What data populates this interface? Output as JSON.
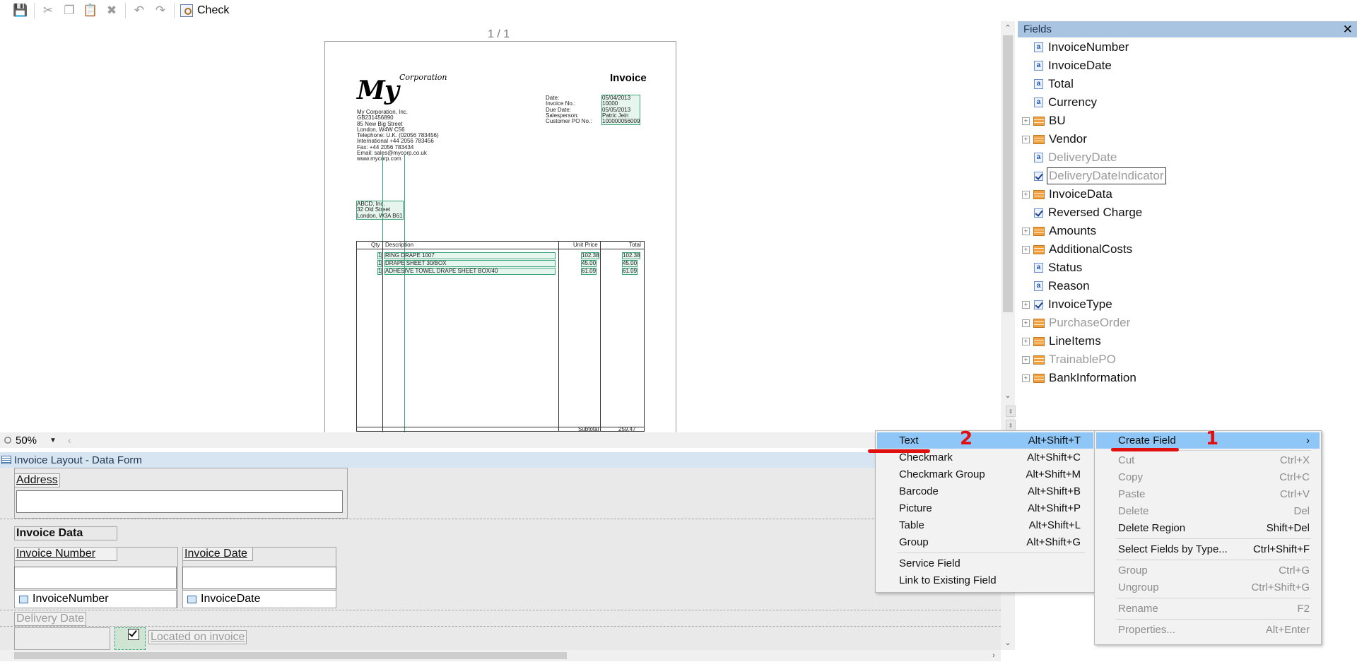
{
  "toolbar": {
    "check_label": "Check"
  },
  "viewer": {
    "page_counter": "1 / 1",
    "zoom": "50%",
    "doc": {
      "title": "Invoice",
      "logo_main": "My",
      "logo_sub": "Corporation",
      "company_block": "My Corporation, Inc.\nGB231456890\n85 New Big Street\nLondon, W4W C56\nTelephone: U.K. (02056 783456)\nInternational +44 2056 783456\nFax: +44 2056 783434\nEmail: sales@mycorp.co.uk\nwww.mycorp.com",
      "meta_labels": "Date:\nInvoice No.:\nDue Date:\nSalesperson:\nCustomer PO No.:",
      "meta_values": "05/04/2013\n10000\n05/05/2013\nPatric Jein\n100000056009",
      "customer_block": "ABCD, Inc.\n32 Old Street\nLondon, W3A B61",
      "table_headers": {
        "qty": "Qty",
        "description": "Description",
        "unit_price": "Unit Price",
        "total": "Total"
      },
      "table_rows": [
        {
          "qty": "1",
          "description": "RING DRAPE 1007",
          "unit_price": "102.38",
          "total": "102.38"
        },
        {
          "qty": "1",
          "description": "DRAPE SHEET 30/BOX",
          "unit_price": "45.00",
          "total": "45.00"
        },
        {
          "qty": "1",
          "description": "ADHESIVE TOWEL DRAPE SHEET BOX/40",
          "unit_price": "61.09",
          "total": "61.09"
        }
      ],
      "subtotal_label": "Subtotal",
      "subtotal_value": "259.47"
    }
  },
  "fields_panel": {
    "title": "Fields",
    "items": [
      {
        "label": "InvoiceNumber",
        "icon": "text-field-icon",
        "expandable": false,
        "disabled": false
      },
      {
        "label": "InvoiceDate",
        "icon": "text-field-icon",
        "expandable": false,
        "disabled": false
      },
      {
        "label": "Total",
        "icon": "text-field-icon",
        "expandable": false,
        "disabled": false
      },
      {
        "label": "Currency",
        "icon": "text-field-icon",
        "expandable": false,
        "disabled": false
      },
      {
        "label": "BU",
        "icon": "group-icon",
        "expandable": true,
        "disabled": false
      },
      {
        "label": "Vendor",
        "icon": "group-icon",
        "expandable": true,
        "disabled": false
      },
      {
        "label": "DeliveryDate",
        "icon": "text-field-icon",
        "expandable": false,
        "disabled": true
      },
      {
        "label": "DeliveryDateIndicator",
        "icon": "checkmark-icon",
        "expandable": false,
        "disabled": true,
        "selected": true
      },
      {
        "label": "InvoiceData",
        "icon": "group-icon",
        "expandable": true,
        "disabled": false
      },
      {
        "label": "Reversed Charge",
        "icon": "checkmark-icon",
        "expandable": false,
        "disabled": false
      },
      {
        "label": "Amounts",
        "icon": "group-icon",
        "expandable": true,
        "disabled": false
      },
      {
        "label": "AdditionalCosts",
        "icon": "group-icon",
        "expandable": true,
        "disabled": false
      },
      {
        "label": "Status",
        "icon": "text-field-icon",
        "expandable": false,
        "disabled": false
      },
      {
        "label": "Reason",
        "icon": "text-field-icon",
        "expandable": false,
        "disabled": false
      },
      {
        "label": "InvoiceType",
        "icon": "checkmark-icon",
        "expandable": true,
        "disabled": false
      },
      {
        "label": "PurchaseOrder",
        "icon": "group-icon",
        "expandable": true,
        "disabled": true
      },
      {
        "label": "LineItems",
        "icon": "group-icon",
        "expandable": true,
        "disabled": false
      },
      {
        "label": "TrainablePO",
        "icon": "group-icon",
        "expandable": true,
        "disabled": true
      },
      {
        "label": "BankInformation",
        "icon": "group-icon",
        "expandable": true,
        "disabled": false
      }
    ]
  },
  "data_form": {
    "title": "Invoice Layout - Data Form",
    "address_label": "Address",
    "invoice_data_label": "Invoice Data",
    "invoice_number_label": "Invoice Number",
    "invoice_date_label": "Invoice Date",
    "invoice_number_source": "InvoiceNumber",
    "invoice_date_source": "InvoiceDate",
    "delivery_date_label": "Delivery Date",
    "located_label": "Located on invoice"
  },
  "submenu": {
    "items": [
      {
        "label": "Text",
        "shortcut": "Alt+Shift+T",
        "highlight": true
      },
      {
        "label": "Checkmark",
        "shortcut": "Alt+Shift+C"
      },
      {
        "label": "Checkmark Group",
        "shortcut": "Alt+Shift+M"
      },
      {
        "label": "Barcode",
        "shortcut": "Alt+Shift+B"
      },
      {
        "label": "Picture",
        "shortcut": "Alt+Shift+P"
      },
      {
        "label": "Table",
        "shortcut": "Alt+Shift+L"
      },
      {
        "label": "Group",
        "shortcut": "Alt+Shift+G"
      },
      {
        "label": "Service Field",
        "shortcut": ""
      },
      {
        "label": "Link to Existing Field",
        "shortcut": ""
      }
    ]
  },
  "context_menu": {
    "items": [
      {
        "label": "Create Field",
        "shortcut": "›",
        "highlight": true
      },
      {
        "label": "Cut",
        "shortcut": "Ctrl+X",
        "disabled": true
      },
      {
        "label": "Copy",
        "shortcut": "Ctrl+C",
        "disabled": true
      },
      {
        "label": "Paste",
        "shortcut": "Ctrl+V",
        "disabled": true
      },
      {
        "label": "Delete",
        "shortcut": "Del",
        "disabled": true
      },
      {
        "label": "Delete Region",
        "shortcut": "Shift+Del"
      },
      {
        "label": "Select Fields by Type...",
        "shortcut": "Ctrl+Shift+F"
      },
      {
        "label": "Group",
        "shortcut": "Ctrl+G",
        "disabled": true
      },
      {
        "label": "Ungroup",
        "shortcut": "Ctrl+Shift+G",
        "disabled": true
      },
      {
        "label": "Rename",
        "shortcut": "F2",
        "disabled": true
      },
      {
        "label": "Properties...",
        "shortcut": "Alt+Enter",
        "disabled": true
      }
    ]
  },
  "annotations": {
    "step1": "1",
    "step2": "2",
    "color": "#e01010"
  }
}
